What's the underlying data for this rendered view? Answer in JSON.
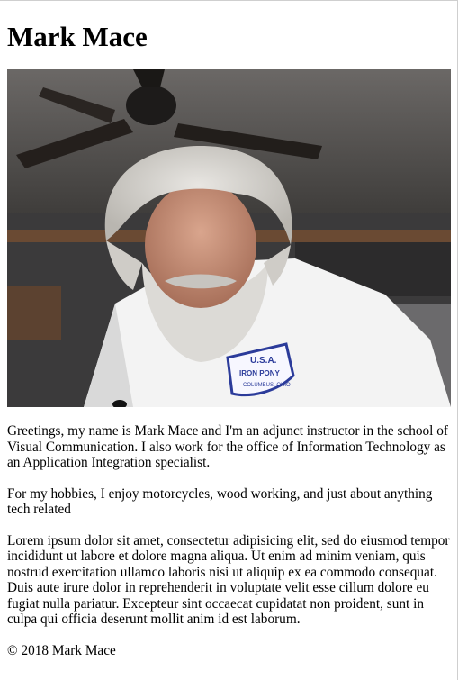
{
  "header": {
    "title": "Mark Mace"
  },
  "photo": {
    "label": "portrait-photo",
    "shirt_text": [
      "U.S.A.",
      "IRON PONY",
      "COLUMBUS, OHIO"
    ]
  },
  "content": {
    "paragraphs": [
      "Greetings, my name is Mark Mace and I'm an adjunct instructor in the school of Visual Communication. I also work for the office of Information Technology as an Application Integration specialist.",
      "For my hobbies, I enjoy motorcycles, wood working, and just about anything tech related",
      "Lorem ipsum dolor sit amet, consectetur adipisicing elit, sed do eiusmod tempor incididunt ut labore et dolore magna aliqua. Ut enim ad minim veniam, quis nostrud exercitation ullamco laboris nisi ut aliquip ex ea commodo consequat. Duis aute irure dolor in reprehenderit in voluptate velit esse cillum dolore eu fugiat nulla pariatur. Excepteur sint occaecat cupidatat non proident, sunt in culpa qui officia deserunt mollit anim id est laborum."
    ]
  },
  "footer": {
    "copyright": "© 2018 Mark Mace"
  }
}
